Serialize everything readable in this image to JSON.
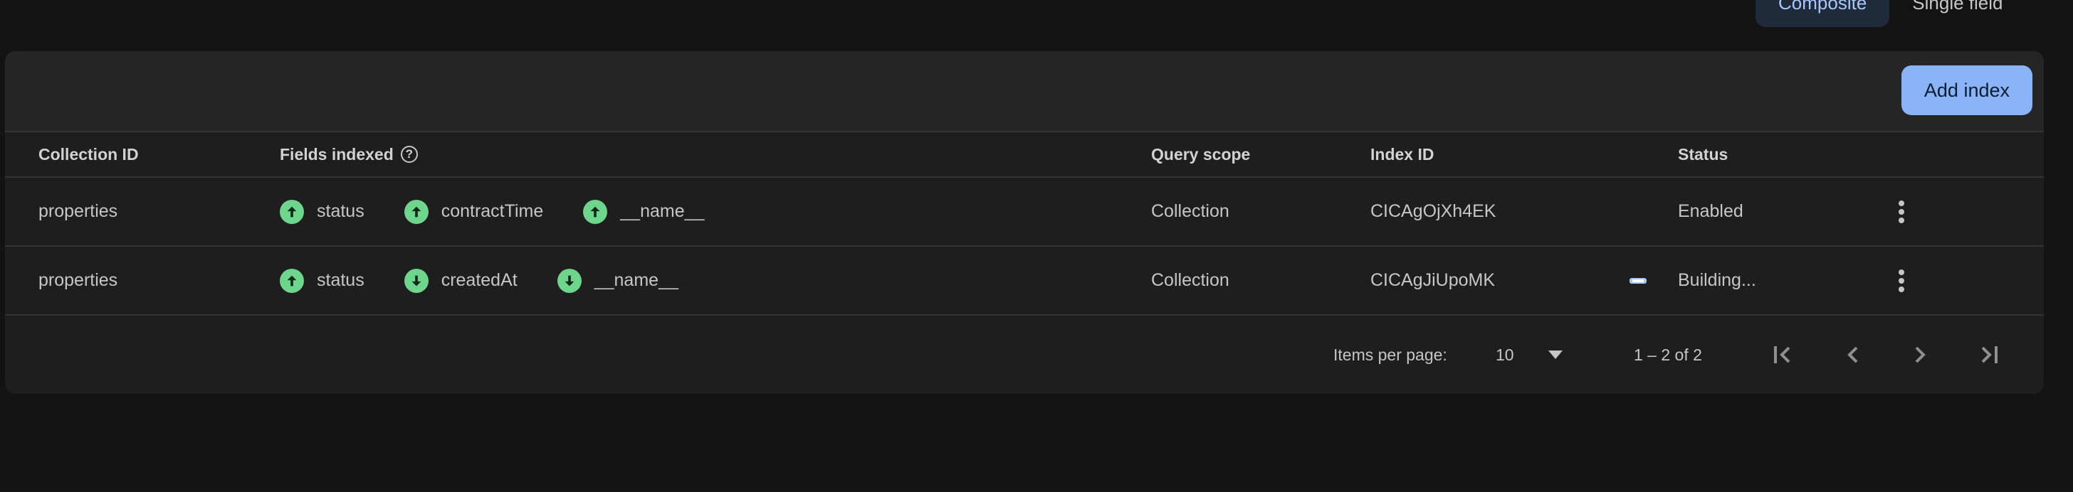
{
  "mode_toggle": {
    "composite_label": "Composite",
    "single_field_label": "Single field"
  },
  "toolbar": {
    "add_index_label": "Add index"
  },
  "table": {
    "headers": {
      "collection_id": "Collection ID",
      "fields_indexed": "Fields indexed",
      "query_scope": "Query scope",
      "index_id": "Index ID",
      "status": "Status"
    },
    "rows": [
      {
        "collection_id": "properties",
        "fields": [
          {
            "name": "status",
            "direction": "ascending",
            "icon": "arrow-up-icon"
          },
          {
            "name": "contractTime",
            "direction": "ascending",
            "icon": "arrow-up-icon"
          },
          {
            "name": "__name__",
            "direction": "ascending",
            "icon": "arrow-up-icon"
          }
        ],
        "query_scope": "Collection",
        "index_id": "CICAgOjXh4EK",
        "status": "Enabled"
      },
      {
        "collection_id": "properties",
        "fields": [
          {
            "name": "status",
            "direction": "ascending",
            "icon": "arrow-up-icon"
          },
          {
            "name": "createdAt",
            "direction": "descending",
            "icon": "arrow-down-icon"
          },
          {
            "name": "__name__",
            "direction": "descending",
            "icon": "arrow-down-icon"
          }
        ],
        "query_scope": "Collection",
        "index_id": "CICAgJiUpoMK",
        "status": "Building..."
      }
    ]
  },
  "paginator": {
    "items_per_page_label": "Items per page:",
    "items_per_page_value": "10",
    "range_label": "1 – 2 of 2"
  },
  "colors": {
    "accent": "#8ab4f8",
    "ascending_badge": "#6dd58c",
    "card_bg": "#1e1e1e",
    "page_bg": "#131313"
  }
}
